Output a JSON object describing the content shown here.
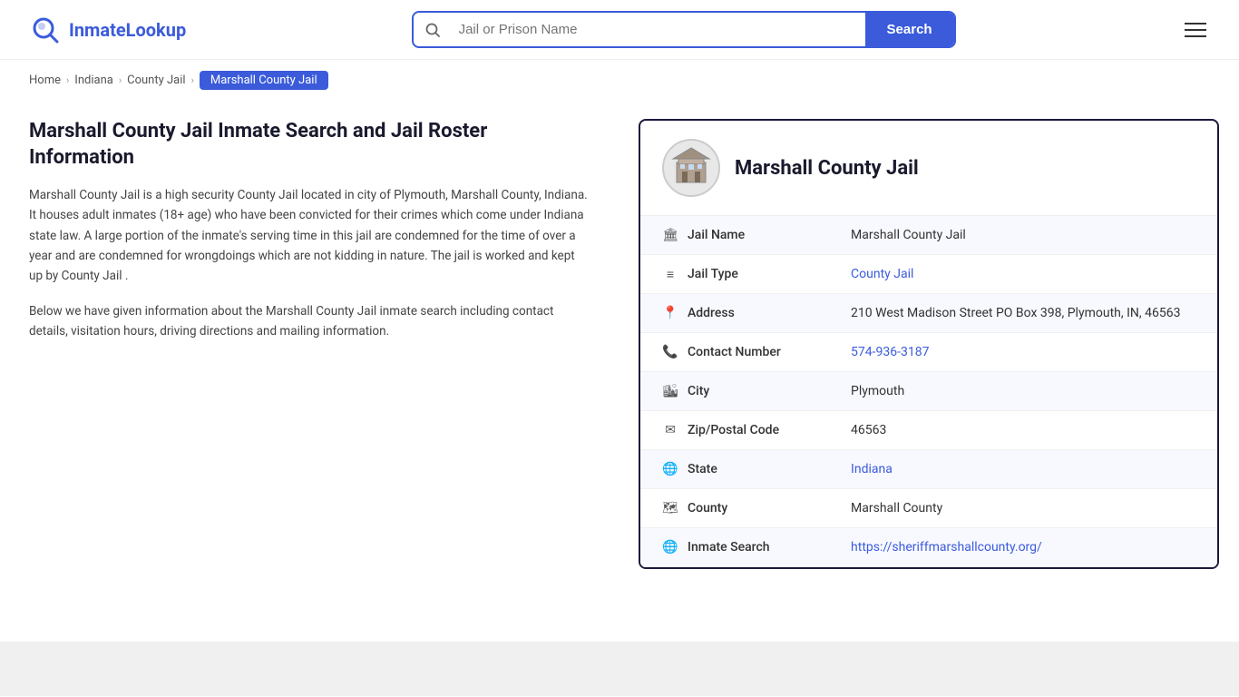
{
  "logo": {
    "icon_label": "inmate-lookup-logo-icon",
    "text_prefix": "Inmate",
    "text_suffix": "Lookup"
  },
  "header": {
    "search_placeholder": "Jail or Prison Name",
    "search_button_label": "Search"
  },
  "breadcrumb": {
    "items": [
      {
        "label": "Home",
        "href": "#"
      },
      {
        "label": "Indiana",
        "href": "#"
      },
      {
        "label": "County Jail",
        "href": "#"
      },
      {
        "label": "Marshall County Jail",
        "active": true
      }
    ]
  },
  "left_panel": {
    "heading": "Marshall County Jail Inmate Search and Jail Roster Information",
    "paragraph1": "Marshall County Jail is a high security County Jail located in city of Plymouth, Marshall County, Indiana. It houses adult inmates (18+ age) who have been convicted for their crimes which come under Indiana state law. A large portion of the inmate's serving time in this jail are condemned for the time of over a year and are condemned for wrongdoings which are not kidding in nature. The jail is worked and kept up by County Jail .",
    "paragraph2": "Below we have given information about the Marshall County Jail inmate search including contact details, visitation hours, driving directions and mailing information."
  },
  "info_card": {
    "title": "Marshall County Jail",
    "rows": [
      {
        "id": "jail-name",
        "icon": "🏛",
        "label": "Jail Name",
        "value": "Marshall County Jail",
        "link": null
      },
      {
        "id": "jail-type",
        "icon": "≡",
        "label": "Jail Type",
        "value": "County Jail",
        "link": "#"
      },
      {
        "id": "address",
        "icon": "📍",
        "label": "Address",
        "value": "210 West Madison Street PO Box 398, Plymouth, IN, 46563",
        "link": null
      },
      {
        "id": "contact-number",
        "icon": "📞",
        "label": "Contact Number",
        "value": "574-936-3187",
        "link": "tel:574-936-3187"
      },
      {
        "id": "city",
        "icon": "🏙",
        "label": "City",
        "value": "Plymouth",
        "link": null
      },
      {
        "id": "zip",
        "icon": "✉",
        "label": "Zip/Postal Code",
        "value": "46563",
        "link": null
      },
      {
        "id": "state",
        "icon": "🌐",
        "label": "State",
        "value": "Indiana",
        "link": "#"
      },
      {
        "id": "county",
        "icon": "🗺",
        "label": "County",
        "value": "Marshall County",
        "link": null
      },
      {
        "id": "inmate-search",
        "icon": "🌐",
        "label": "Inmate Search",
        "value": "https://sheriffmarshallcounty.org/",
        "link": "https://sheriffmarshallcounty.org/"
      }
    ]
  }
}
